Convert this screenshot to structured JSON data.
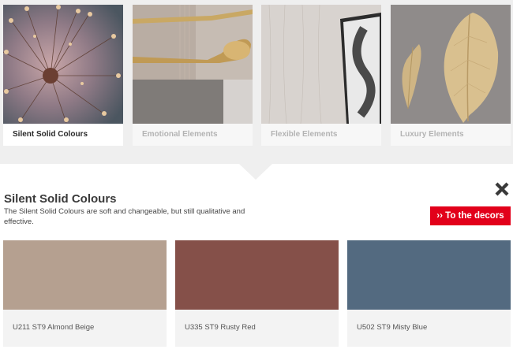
{
  "categories": [
    {
      "label": "Silent Solid Colours",
      "image_icon": "flower-photo"
    },
    {
      "label": "Emotional Elements",
      "image_icon": "cutlery-photo"
    },
    {
      "label": "Flexible Elements",
      "image_icon": "frame-photo"
    },
    {
      "label": "Luxury Elements",
      "image_icon": "gold-leaf-photo"
    }
  ],
  "detail": {
    "title": "Silent Solid Colours",
    "description": "The Silent Solid Colours are soft and changeable, but still qualitative and effective.",
    "close_icon": "close-icon",
    "button_label": "›› To the decors",
    "button_color": "#e2001a"
  },
  "decors": [
    {
      "name": "U211 ST9 Almond Beige",
      "color": "#b5a090"
    },
    {
      "name": "U335 ST9 Rusty Red",
      "color": "#855049"
    },
    {
      "name": "U502 ST9 Misty Blue",
      "color": "#536a80"
    }
  ]
}
